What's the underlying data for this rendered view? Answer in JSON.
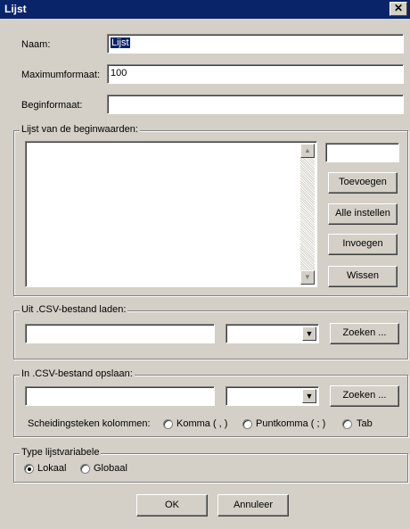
{
  "window": {
    "title": "Lijst",
    "close_glyph": "✕"
  },
  "form": {
    "naam_label": "Naam:",
    "naam_value": "Lijst",
    "maxformaat_label": "Maximumformaat:",
    "maxformaat_value": "100",
    "beginformaat_label": "Beginformaat:",
    "beginformaat_value": ""
  },
  "values_group": {
    "title": "Lijst van de beginwaarden:",
    "entry_value": "",
    "buttons": {
      "add": "Toevoegen",
      "set_all": "Alle instellen",
      "insert": "Invoegen",
      "clear": "Wissen"
    }
  },
  "csv_load": {
    "title": "Uit .CSV-bestand laden:",
    "file_value": "",
    "encoding_value": "",
    "browse": "Zoeken ..."
  },
  "csv_save": {
    "title": "In .CSV-bestand opslaan:",
    "file_value": "",
    "encoding_value": "",
    "browse": "Zoeken ...",
    "separator_label": "Scheidingsteken kolommen:",
    "options": [
      "Komma ( , )",
      "Puntkomma ( ; )",
      "Tab"
    ],
    "selected_option": null
  },
  "list_type": {
    "title": "Type lijstvariabele",
    "options": [
      "Lokaal",
      "Globaal"
    ],
    "selected": "Lokaal"
  },
  "footer": {
    "ok": "OK",
    "cancel": "Annuleer"
  },
  "colors": {
    "face": "#d4d0c8",
    "title_bar": "#0a246a",
    "selection": "#0a246a"
  }
}
